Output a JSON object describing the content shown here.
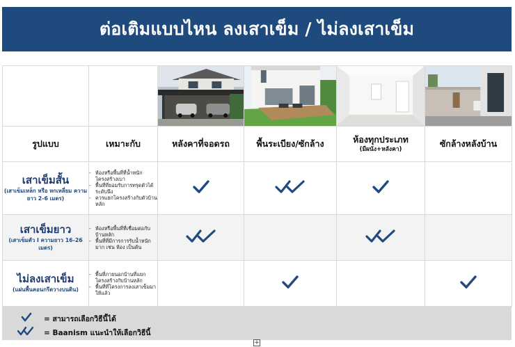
{
  "title": "ต่อเติมแบบไหน ลงเสาเข็ม / ไม่ลงเสาเข็ม",
  "colors": {
    "brand": "#1e4a7e",
    "check": "#1e4a7e",
    "legend_bg": "#d9d9d9"
  },
  "table": {
    "header": {
      "type_label": "รูปแบบ",
      "fit_label": "เหมาะกับ",
      "columns": [
        {
          "label": "หลังคาที่จอดรถ",
          "sub": ""
        },
        {
          "label": "พื้นระเบียง/ซักล้าง",
          "sub": ""
        },
        {
          "label": "ห้องทุกประเภท",
          "sub": "(มีผนัง+หลังคา)"
        },
        {
          "label": "ซักล้างหลังบ้าน",
          "sub": ""
        }
      ]
    },
    "rows": [
      {
        "name": "เสาเข็มสั้น",
        "sub": "(เสาเข็มเหล็ก หรือ หกเหลี่ยม ความยาว 2-6 เมตร)",
        "fit": [
          "ห้องหรือพื้นที่ที่น้ำหนักโครงสร้างเบา",
          "พื้นที่ที่ยอมรับการทรุดตัวได้ระดับนึง",
          "ควรแยกโครงสร้างกับตัวบ้านหลัก"
        ],
        "marks": [
          "single",
          "double",
          "single",
          "none"
        ]
      },
      {
        "name": "เสาเข็มยาว",
        "sub": "(เสาเข็มตัว I ความยาว 16-26 เมตร)",
        "fit": [
          "ห้องหรือพื้นที่ที่เชื่อมต่อกับบ้านหลัก",
          "พื้นที่ที่มีการการรับน้ำหนักมาก เช่น ห้อง เป็นต้น"
        ],
        "marks": [
          "double",
          "none",
          "double",
          "none"
        ]
      },
      {
        "name": "ไม่ลงเสาเข็ม",
        "sub": "(แผ่นพื้นคอนกรีตวางบนดิน)",
        "fit": [
          "พื้นที่ภายนอกบ้านที่แยกโครงสร้างกับบ้านหลัก",
          "พื้นที่ที่โครงการลงเสาเข็มมาให้แล้ว"
        ],
        "marks": [
          "none",
          "single",
          "none",
          "single"
        ]
      }
    ]
  },
  "legend": {
    "single_text": "= สามารถเลือกวิธีนี้ได้",
    "double_text": "= Baanism แนะนำให้เลือกวิธีนี้"
  },
  "icons": {
    "single": "check-icon",
    "double": "double-check-icon",
    "plus": "plus-box-icon"
  }
}
